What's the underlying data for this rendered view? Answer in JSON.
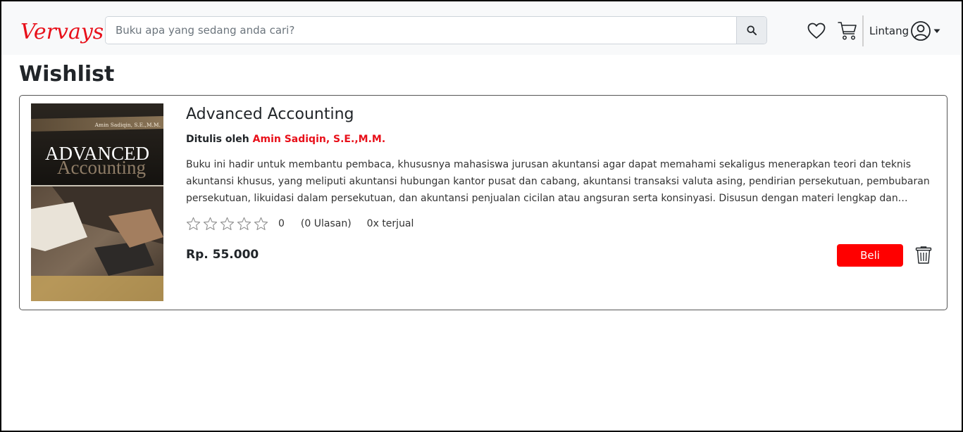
{
  "navbar": {
    "brand": "Vervays",
    "search_placeholder": "Buku apa yang sedang anda cari?",
    "search_value": "",
    "user_name": "Lintang"
  },
  "page": {
    "title": "Wishlist"
  },
  "wishlist": [
    {
      "cover": {
        "author_text": "Amin Sadiqin, S.E.,M.M.",
        "title_line1": "ADVANCED",
        "title_line2": "Accounting"
      },
      "title": "Advanced Accounting",
      "author_prefix": "Ditulis oleh",
      "author": "Amin Sadiqin, S.E.,M.M.",
      "description": "Buku ini hadir untuk membantu pembaca, khususnya mahasiswa jurusan akuntansi agar dapat memahami sekaligus menerapkan teori dan teknis akuntansi khusus, yang meliputi akuntansi hubungan kantor pusat dan cabang, akuntansi transaksi valuta asing, pendirian persekutuan, pembubaran persekutuan, likuidasi dalam persekutuan, dan akuntansi penjualan cicilan atau angsuran serta konsinyasi. Disusun dengan materi lengkap dan…",
      "rating_value": "0",
      "rating_stars": 0,
      "reviews": "(0 Ulasan)",
      "sold": "0x terjual",
      "price": "Rp. 55.000",
      "buy_label": "Beli"
    }
  ],
  "colors": {
    "brand": "#e8101a",
    "buy_button": "#ff0000",
    "navbar_bg": "#f8f9fa"
  }
}
